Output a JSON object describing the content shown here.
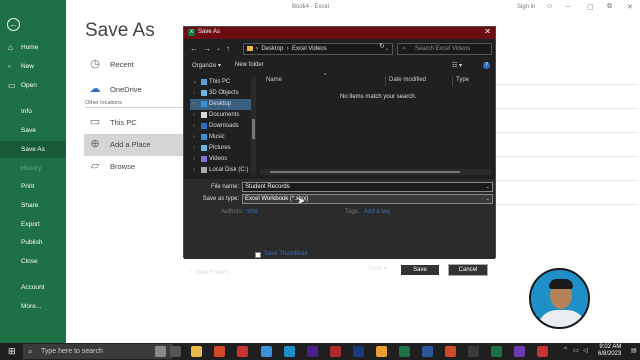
{
  "window": {
    "doc_title": "Book4  -  Excel",
    "sign_in": "Sign in"
  },
  "backstage": {
    "title": "Save As",
    "menu": [
      {
        "label": "Home",
        "icon": "home-icon"
      },
      {
        "label": "New",
        "icon": "new-icon"
      },
      {
        "label": "Open",
        "icon": "open-icon"
      },
      {
        "label": "Info",
        "icon": ""
      },
      {
        "label": "Save",
        "icon": ""
      },
      {
        "label": "Save As",
        "icon": ""
      },
      {
        "label": "History",
        "icon": ""
      },
      {
        "label": "Print",
        "icon": ""
      },
      {
        "label": "Share",
        "icon": ""
      },
      {
        "label": "Export",
        "icon": ""
      },
      {
        "label": "Publish",
        "icon": ""
      },
      {
        "label": "Close",
        "icon": ""
      },
      {
        "label": "Account",
        "icon": ""
      },
      {
        "label": "More...",
        "icon": ""
      }
    ],
    "places": {
      "recent": "Recent",
      "onedrive": "OneDrive",
      "other_locations": "Other locations",
      "this_pc": "This PC",
      "add_place": "Add a Place",
      "browse": "Browse"
    }
  },
  "dialog": {
    "title": "Save As",
    "breadcrumb": [
      "Desktop",
      "Excel Videos"
    ],
    "search_placeholder": "Search Excel Videos",
    "organize": "Organize",
    "new_folder": "New folder",
    "nav_items": [
      {
        "label": "This PC"
      },
      {
        "label": "3D Objects"
      },
      {
        "label": "Desktop"
      },
      {
        "label": "Documents"
      },
      {
        "label": "Downloads"
      },
      {
        "label": "Music"
      },
      {
        "label": "Pictures"
      },
      {
        "label": "Videos"
      },
      {
        "label": "Local Disk (C:)"
      }
    ],
    "columns": [
      "Name",
      "Date modified",
      "Type"
    ],
    "empty_message": "No items match your search.",
    "file_name_label": "File name:",
    "file_name_value": "Student Records",
    "save_type_label": "Save as type:",
    "save_type_value": "Excel Workbook (*.xlsx)",
    "authors_label": "Authors:",
    "authors_value": "rohit",
    "tags_label": "Tags:",
    "tags_value": "Add a tag",
    "thumbnail_label": "Save Thumbnail",
    "hide_folders": "Hide Folders",
    "tools": "Tools",
    "save": "Save",
    "cancel": "Cancel"
  },
  "taskbar": {
    "search_placeholder": "Type here to search",
    "time": "9:02 AM",
    "date": "6/8/2023"
  },
  "colors": {
    "excel_green": "#1e7145",
    "dialog_titlebar": "#6b0d12",
    "dialog_bg": "#202020"
  }
}
